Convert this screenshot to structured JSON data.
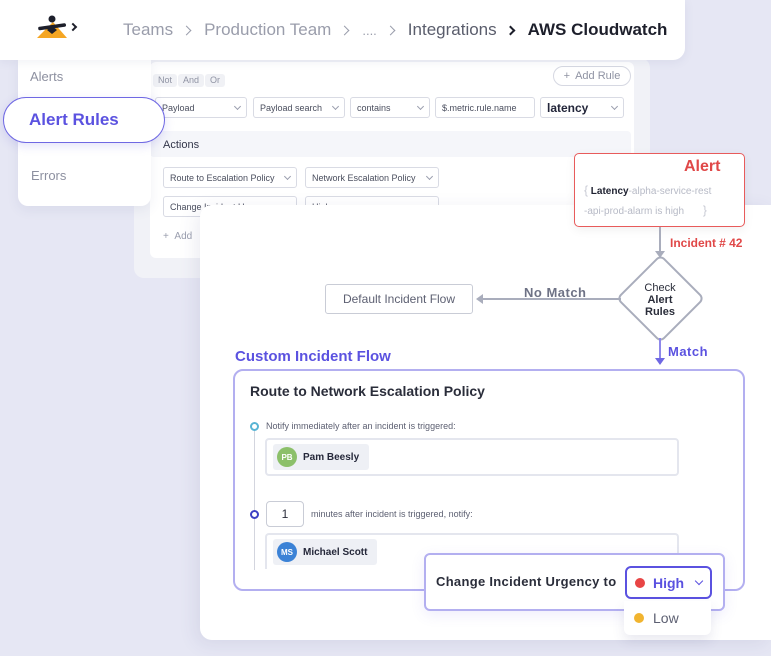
{
  "breadcrumb": {
    "items": [
      "Teams",
      "Production Team",
      "....",
      "Integrations",
      "AWS Cloudwatch"
    ]
  },
  "sidebar": {
    "items": [
      {
        "label": "Alerts"
      },
      {
        "label": "Alert Rules",
        "active": true
      },
      {
        "label": "Errors"
      }
    ]
  },
  "rule_editor": {
    "logic_chips": [
      "Not",
      "And",
      "Or"
    ],
    "add_rule_label": "Add Rule",
    "condition": {
      "field": "Payload",
      "search": "Payload search",
      "operator": "contains",
      "path": "$.metric.rule.name",
      "value": "latency"
    },
    "actions_title": "Actions",
    "actions": [
      {
        "type": "Route to Escalation Policy",
        "value": "Network Escalation Policy"
      },
      {
        "type": "Change Incident Urgency",
        "value": "High"
      }
    ],
    "add_action_label": "Add"
  },
  "flow": {
    "alert": {
      "title": "Alert",
      "keyword": "Latency",
      "message_rest_line1": "-alpha-service-rest",
      "message_rest_line2": "-api-prod-alarm is high"
    },
    "incident_label": "Incident",
    "incident_number": "# 42",
    "decision_line1": "Check",
    "decision_line2": "Alert",
    "decision_line3": "Rules",
    "no_match_label": "No Match",
    "match_label": "Match",
    "default_flow_label": "Default Incident Flow",
    "custom_flow_title": "Custom Incident Flow",
    "route_title": "Route to Network Escalation Policy",
    "step1_text": "Notify immediately after an incident is triggered:",
    "step1_user": {
      "initials": "PB",
      "name": "Pam Beesly",
      "color": "#8cc06a"
    },
    "step2_minutes": "1",
    "step2_text": "minutes after incident is triggered, notify:",
    "step2_user": {
      "initials": "MS",
      "name": "Michael Scott",
      "color": "#3b82d6"
    },
    "urgency_label": "Change Incident Urgency to",
    "urgency_selected": {
      "label": "High",
      "color": "#e84545"
    },
    "urgency_options": [
      {
        "label": "Low",
        "color": "#f1b42f"
      }
    ]
  },
  "colors": {
    "accent": "#5b52e0",
    "alert_red": "#e04848"
  }
}
